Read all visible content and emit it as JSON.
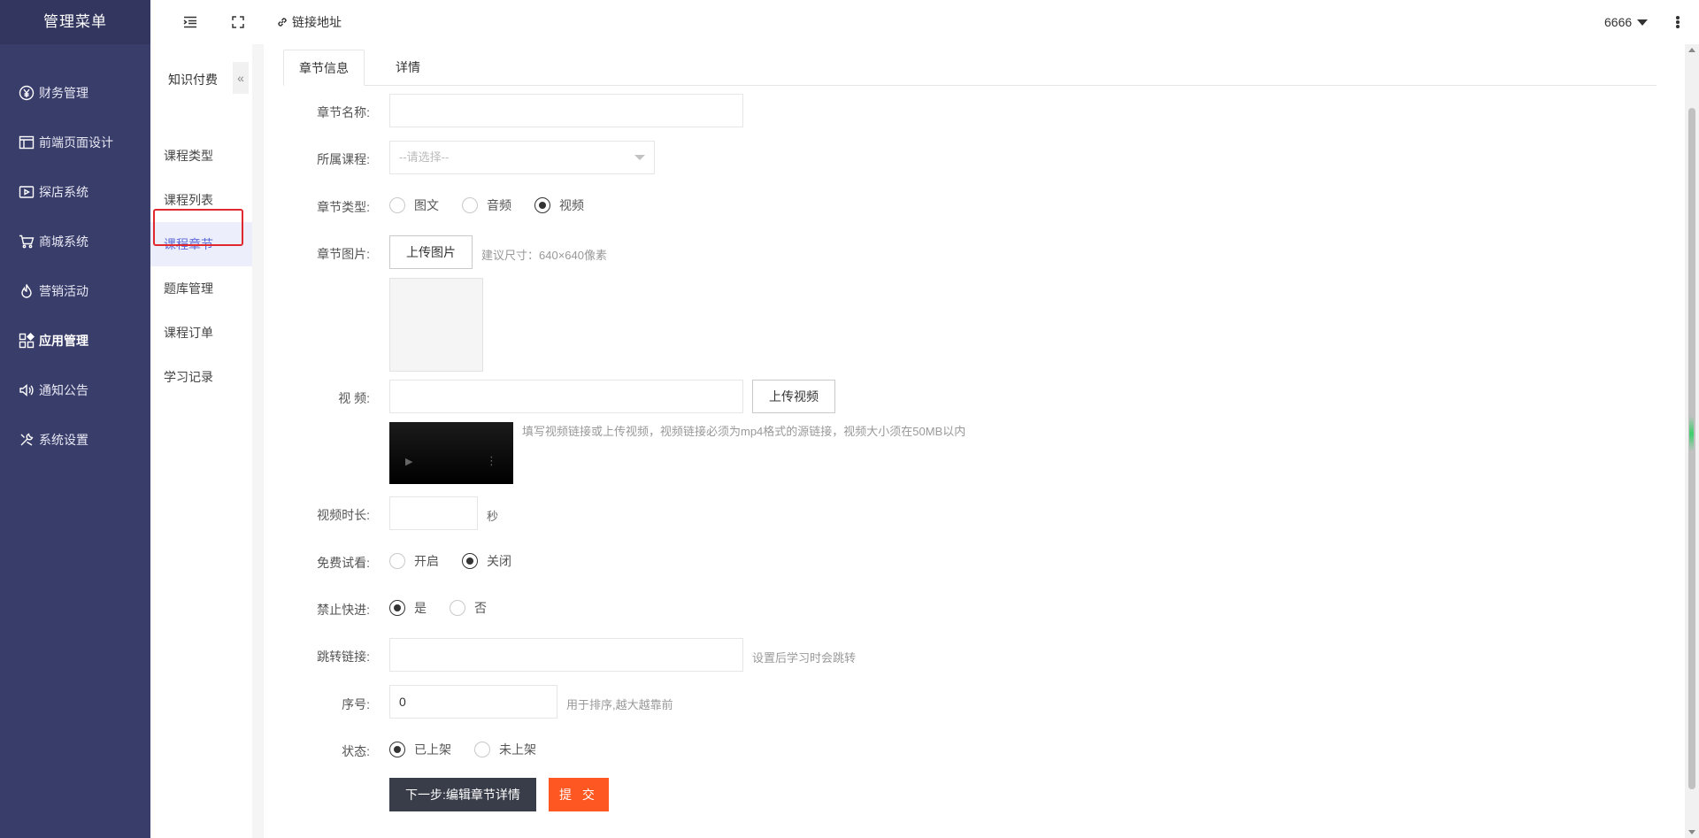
{
  "sidebar": {
    "brand": "管理菜单",
    "items": [
      {
        "label": "财务管理",
        "icon": "yen-icon"
      },
      {
        "label": "前端页面设计",
        "icon": "layout-icon"
      },
      {
        "label": "探店系统",
        "icon": "video-icon"
      },
      {
        "label": "商城系统",
        "icon": "cart-icon"
      },
      {
        "label": "营销活动",
        "icon": "flame-icon"
      },
      {
        "label": "应用管理",
        "icon": "apps-icon"
      },
      {
        "label": "通知公告",
        "icon": "speaker-icon"
      },
      {
        "label": "系统设置",
        "icon": "tools-icon"
      }
    ]
  },
  "header": {
    "link_label": "链接地址",
    "user": "6666"
  },
  "subnav": {
    "title": "知识付费",
    "collapse": "«",
    "items": [
      "课程类型",
      "课程列表",
      "课程章节",
      "题库管理",
      "课程订单",
      "学习记录"
    ]
  },
  "tabs": [
    "章节信息",
    "详情"
  ],
  "form": {
    "chapter_name": {
      "label": "章节名称:",
      "value": ""
    },
    "course": {
      "label": "所属课程:",
      "placeholder": "--请选择--"
    },
    "chapter_type": {
      "label": "章节类型:",
      "options": [
        "图文",
        "音频",
        "视频"
      ],
      "selected": "视频"
    },
    "chapter_image": {
      "label": "章节图片:",
      "button": "上传图片",
      "hint": "建议尺寸：640×640像素"
    },
    "video": {
      "label": "视 频:",
      "value": "",
      "button": "上传视频",
      "hint": "填写视频链接或上传视频，视频链接必须为mp4格式的源链接，视频大小须在50MB以内"
    },
    "duration": {
      "label": "视频时长:",
      "value": "",
      "unit": "秒"
    },
    "free_trial": {
      "label": "免费试看:",
      "options": [
        "开启",
        "关闭"
      ],
      "selected": "关闭"
    },
    "no_fast_forward": {
      "label": "禁止快进:",
      "options": [
        "是",
        "否"
      ],
      "selected": "是"
    },
    "jump_link": {
      "label": "跳转链接:",
      "value": "",
      "hint": "设置后学习时会跳转"
    },
    "sort": {
      "label": "序号:",
      "value": "0",
      "hint": "用于排序,越大越靠前"
    },
    "status": {
      "label": "状态:",
      "options": [
        "已上架",
        "未上架"
      ],
      "selected": "已上架"
    },
    "next_button": "下一步:编辑章节详情",
    "submit_button": "提 交"
  },
  "colors": {
    "sidebar_bg": "#393d6a",
    "active_sub": "#5b6ad6",
    "submit": "#ff5722",
    "dark_button": "#393d49",
    "highlight": "#e0282e"
  }
}
